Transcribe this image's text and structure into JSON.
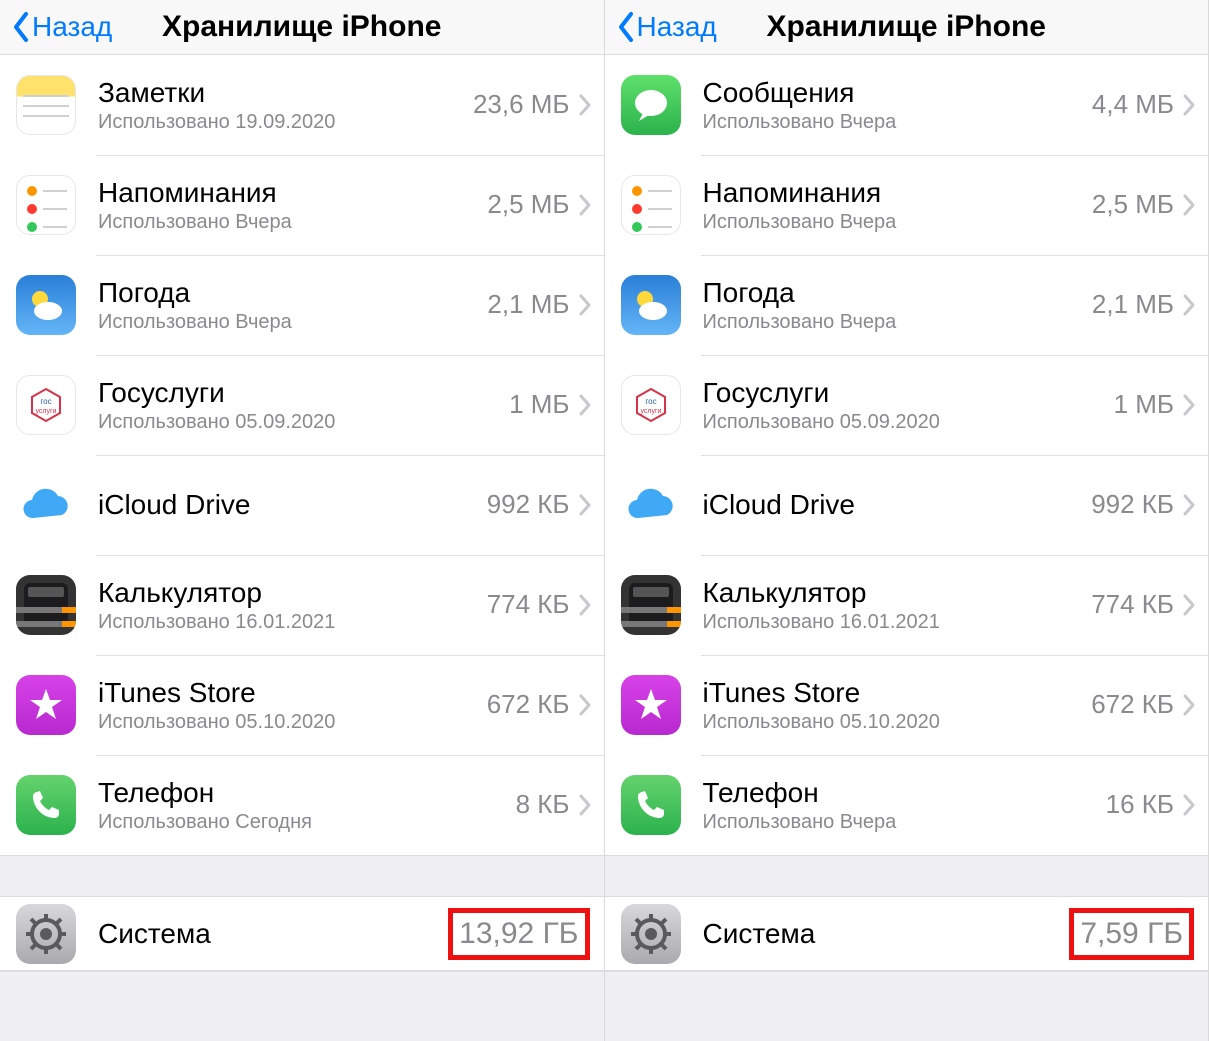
{
  "screens": [
    {
      "back_label": "Назад",
      "title": "Хранилище iPhone",
      "apps": [
        {
          "icon": "notes",
          "name": "Заметки",
          "sub": "Использовано 19.09.2020",
          "size": "23,6 МБ"
        },
        {
          "icon": "reminders",
          "name": "Напоминания",
          "sub": "Использовано Вчера",
          "size": "2,5 МБ"
        },
        {
          "icon": "weather",
          "name": "Погода",
          "sub": "Использовано Вчера",
          "size": "2,1 МБ"
        },
        {
          "icon": "gos",
          "name": "Госуслуги",
          "sub": "Использовано 05.09.2020",
          "size": "1 МБ"
        },
        {
          "icon": "icloud",
          "name": "iCloud Drive",
          "sub": "",
          "size": "992 КБ"
        },
        {
          "icon": "calc",
          "name": "Калькулятор",
          "sub": "Использовано 16.01.2021",
          "size": "774 КБ"
        },
        {
          "icon": "itunes",
          "name": "iTunes Store",
          "sub": "Использовано 05.10.2020",
          "size": "672 КБ"
        },
        {
          "icon": "phone",
          "name": "Телефон",
          "sub": "Использовано Сегодня",
          "size": "8 КБ"
        }
      ],
      "system": {
        "name": "Система",
        "size": "13,92 ГБ"
      }
    },
    {
      "back_label": "Назад",
      "title": "Хранилище iPhone",
      "apps": [
        {
          "icon": "messages",
          "name": "Сообщения",
          "sub": "Использовано Вчера",
          "size": "4,4 МБ"
        },
        {
          "icon": "reminders",
          "name": "Напоминания",
          "sub": "Использовано Вчера",
          "size": "2,5 МБ"
        },
        {
          "icon": "weather",
          "name": "Погода",
          "sub": "Использовано Вчера",
          "size": "2,1 МБ"
        },
        {
          "icon": "gos",
          "name": "Госуслуги",
          "sub": "Использовано 05.09.2020",
          "size": "1 МБ"
        },
        {
          "icon": "icloud",
          "name": "iCloud Drive",
          "sub": "",
          "size": "992 КБ"
        },
        {
          "icon": "calc",
          "name": "Калькулятор",
          "sub": "Использовано 16.01.2021",
          "size": "774 КБ"
        },
        {
          "icon": "itunes",
          "name": "iTunes Store",
          "sub": "Использовано 05.10.2020",
          "size": "672 КБ"
        },
        {
          "icon": "phone",
          "name": "Телефон",
          "sub": "Использовано Вчера",
          "size": "16 КБ"
        }
      ],
      "system": {
        "name": "Система",
        "size": "7,59 ГБ"
      }
    }
  ]
}
